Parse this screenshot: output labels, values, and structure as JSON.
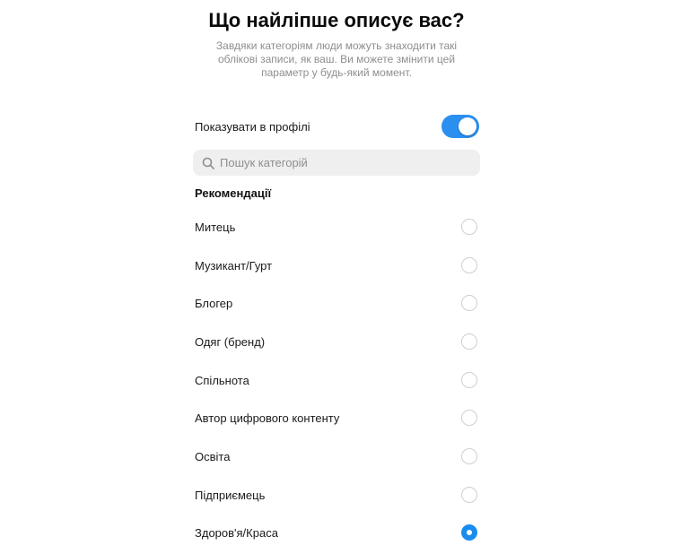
{
  "header": {
    "title": "Що найліпше описує вас?",
    "subtitle": "Завдяки категоріям люди можуть знаходити такі облікові записи, як ваш. Ви можете змінити цей параметр у будь-який момент."
  },
  "profile_toggle": {
    "label": "Показувати в профілі",
    "on": true
  },
  "search": {
    "placeholder": "Пошук категорій",
    "value": ""
  },
  "recommendations": {
    "title": "Рекомендації",
    "items": [
      {
        "label": "Митець",
        "selected": false
      },
      {
        "label": "Музикант/Гурт",
        "selected": false
      },
      {
        "label": "Блогер",
        "selected": false
      },
      {
        "label": "Одяг (бренд)",
        "selected": false
      },
      {
        "label": "Спільнота",
        "selected": false
      },
      {
        "label": "Автор цифрового контенту",
        "selected": false
      },
      {
        "label": "Освіта",
        "selected": false
      },
      {
        "label": "Підприємець",
        "selected": false
      },
      {
        "label": "Здоров'я/Краса",
        "selected": true
      }
    ]
  },
  "colors": {
    "accent": "#1a8cf0",
    "toggle_on": "#2b8ff0",
    "muted_text": "#8e8e8e",
    "search_bg": "#efefef"
  },
  "icons": {
    "search": "search-icon",
    "toggle": "toggle-switch",
    "radio": "radio-button"
  }
}
